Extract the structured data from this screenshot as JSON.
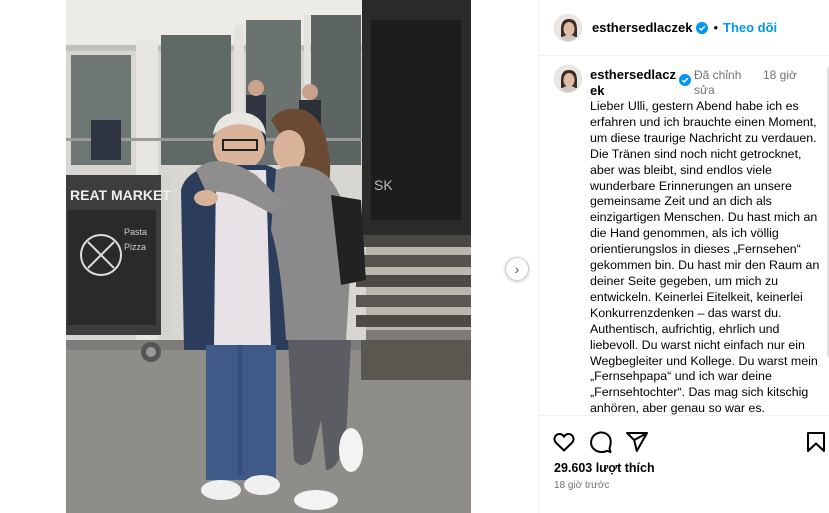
{
  "post": {
    "username": "esthersedlaczek",
    "follow_label": "Theo dõi",
    "separator": "•",
    "caption_username": "esthersedlaczek",
    "edited_label": "Đã chỉnh sửa",
    "time_label": "18 giờ",
    "caption": "Lieber Ulli, gestern Abend habe ich es erfahren und ich brauchte einen Moment, um diese traurige Nachricht zu verdauen. Die Tränen sind noch nicht getrocknet, aber was bleibt, sind endlos viele wunderbare Erinnerungen an unsere gemeinsame Zeit und an dich als einzigartigen Menschen. Du hast mich an die Hand genommen, als ich völlig orientierungslos in dieses „Fernsehen“ gekommen bin. Du hast mir den Raum an deiner Seite gegeben, um mich zu entwickeln. Keinerlei Eitelkeit, keinerlei Konkurrenzdenken – das warst du. Authentisch, aufrichtig, ehrlich und liebevoll. Du warst nicht einfach nur ein Wegbegleiter und Kollege. Du warst mein „Fernsehpapa“ und ich war deine „Fernsehtochter“. Das mag sich kitschig anhören, aber genau so war es.",
    "likes": "29.603 lượt thích",
    "posted_ago": "18 giờ trước"
  },
  "photo": {
    "sign_text": "REAT MARKET",
    "sign_small_1": "Pasta",
    "sign_small_2": "Pizza",
    "door_text": "SK"
  },
  "colors": {
    "accent": "#0095f6",
    "muted": "#737373",
    "divider": "#efefef"
  },
  "icons": [
    "heart-icon",
    "comment-icon",
    "share-icon",
    "bookmark-icon",
    "verified-badge-icon",
    "chevron-right-icon"
  ]
}
